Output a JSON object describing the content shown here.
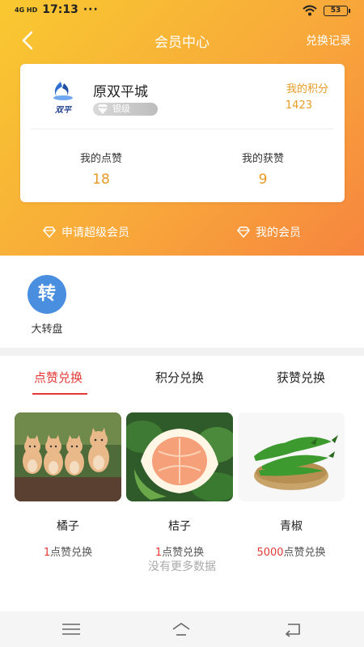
{
  "status_bar": {
    "network": "4G HD",
    "time": "17:13",
    "dots": "···",
    "battery": "53"
  },
  "nav": {
    "title": "会员中心",
    "right_label": "兑换记录"
  },
  "card": {
    "store_name": "原双平城",
    "logo_text": "双平",
    "vip_level": "银级",
    "points_label": "我的积分",
    "points_value": "1423",
    "likes_given_label": "我的点赞",
    "likes_given_value": "18",
    "likes_received_label": "我的获赞",
    "likes_received_value": "9"
  },
  "hero_links": {
    "apply_super": "申请超级会员",
    "my_membership": "我的会员"
  },
  "menu": {
    "wheel_icon_text": "转",
    "wheel_label": "大转盘"
  },
  "tabs": [
    "点赞兑换",
    "积分兑换",
    "获赞兑换"
  ],
  "products": [
    {
      "name": "橘子",
      "price_num": "1",
      "price_unit": "点赞兑换"
    },
    {
      "name": "桔子",
      "price_num": "1",
      "price_unit": "点赞兑换"
    },
    {
      "name": "青椒",
      "price_num": "5000",
      "price_unit": "点赞兑换"
    }
  ],
  "no_more": "没有更多数据",
  "colors": {
    "accent": "#e79b24",
    "tab_active": "#e53935",
    "hero_start": "#f9c930",
    "hero_end": "#f6853f"
  }
}
